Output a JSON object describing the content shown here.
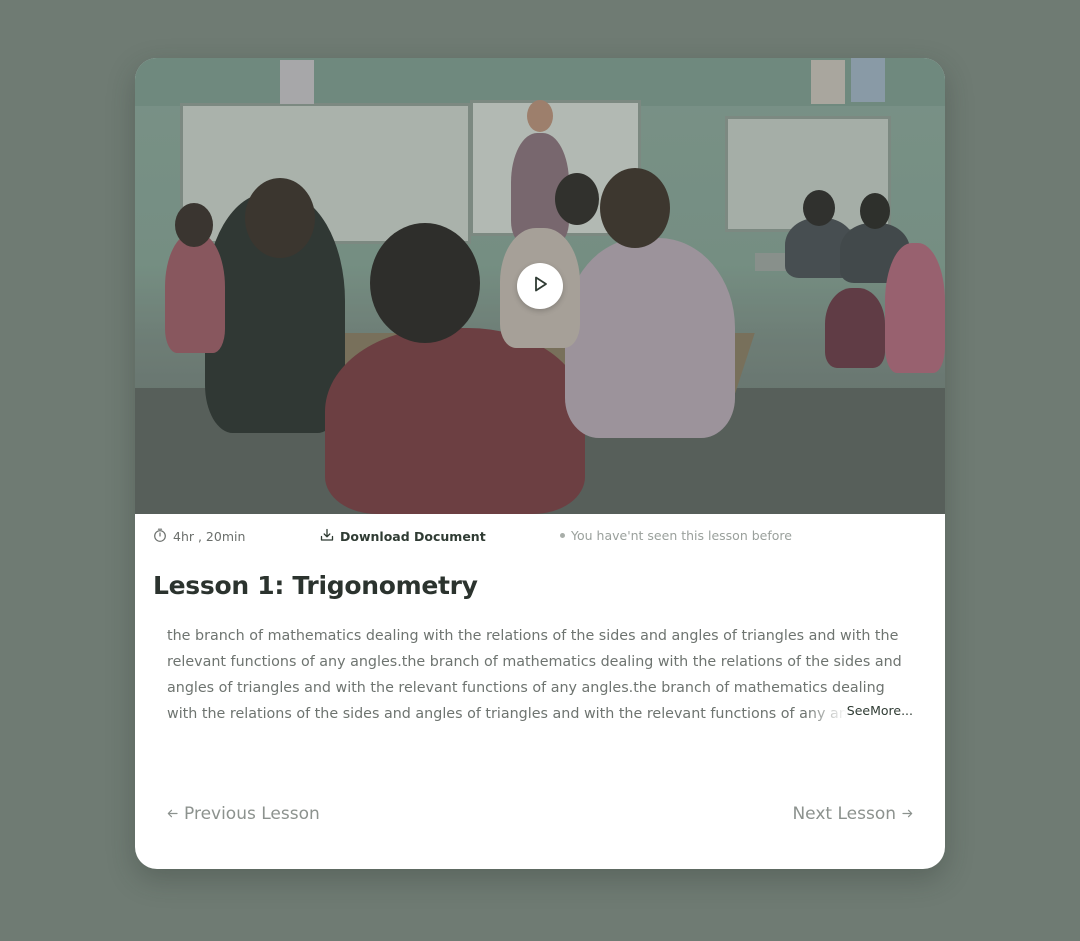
{
  "lesson": {
    "title": "Lesson 1: Trigonometry",
    "description": "the branch of mathematics dealing with the relations of the sides and angles of triangles and with the relevant functions of any angles.the branch of mathematics dealing with the relations of the sides and angles of triangles and with the relevant functions of any angles.the branch of mathematics dealing with the relations of the sides and angles of triangles and with the relevant functions of any angles.",
    "see_more_label": "SeeMore..."
  },
  "meta": {
    "duration": "4hr , 20min",
    "download_label": "Download Document",
    "seen_status": "You have'nt seen this lesson before"
  },
  "navigation": {
    "previous_label": "Previous Lesson",
    "next_label": "Next Lesson"
  },
  "icons": {
    "duration": "stopwatch-icon",
    "download": "download-icon",
    "play": "play-icon",
    "previous": "arrow-left-icon",
    "next": "arrow-right-icon"
  },
  "colors": {
    "page_background": "#6f7b73",
    "card_background": "#ffffff",
    "title": "#2b332e",
    "accent_dark": "#2f3b33",
    "muted": "#8c928e"
  }
}
